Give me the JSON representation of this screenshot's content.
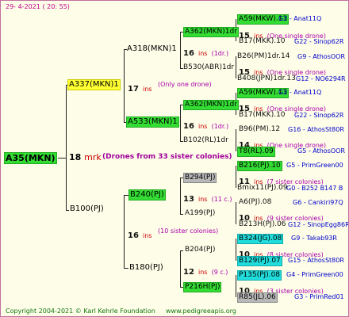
{
  "header": {
    "date": "29-  4-2021  ( 20:  55)"
  },
  "root": {
    "label": "A35(MKN)",
    "num": "18",
    "ins": "mrk",
    "note": "(Drones from 33 sister colonies)"
  },
  "gen1": {
    "top": {
      "label": "A337(MKN)1",
      "num": "17",
      "ins": "ins",
      "note": "(Only one drone)"
    },
    "bottom": {
      "label": "B100(PJ)",
      "num": "16",
      "ins": "ins",
      "note": "(10 sister colonies)"
    }
  },
  "gen2": {
    "a318": {
      "label": "A318(MKN)1",
      "num": "16",
      "ins": "ins",
      "note": "(1dr.)"
    },
    "a533": {
      "label": "A533(MKN)1",
      "num": "16",
      "ins": "ins",
      "note": "(1dr.)"
    },
    "b240": {
      "label": "B240(PJ)",
      "num": "13",
      "ins": "ins",
      "note": "(11 c.)"
    },
    "b180": {
      "label": "B180(PJ)",
      "num": "12",
      "ins": "ins",
      "note": "(9 c.)"
    }
  },
  "gen3": {
    "a362a": {
      "label": "A362(MKN)1dr",
      "num": "15",
      "ins": "ins",
      "note": "(One single drone)"
    },
    "b530": {
      "label": "B530(ABR)1dr",
      "num": "15",
      "ins": "ins",
      "note": "(One single drone)"
    },
    "a362b": {
      "label": "A362(MKN)1dr",
      "num": "15",
      "ins": "ins",
      "note": "(One single drone)"
    },
    "b102": {
      "label": "B102(RL)1dr",
      "num": "14",
      "ins": "ins",
      "note": "(One single drone)"
    },
    "b294": {
      "label": "B294(PJ)",
      "num": "11",
      "ins": "ins",
      "note": "(7 sister colonies)"
    },
    "a199": {
      "label": "A199(PJ)",
      "num": "10",
      "ins": "ins",
      "note": "(9 sister colonies)"
    },
    "b204": {
      "label": "B204(PJ)",
      "num": "10",
      "ins": "ins",
      "note": "(8 sister colonies)"
    },
    "p216": {
      "label": "P216H(PJ)",
      "num": "10",
      "ins": "ins",
      "note": "(3 sister colonies)"
    }
  },
  "gen4": [
    {
      "label": "A59(MKW).13",
      "right": "G2 - Anat11Q"
    },
    {
      "label": "B17(MKK).10",
      "right": "G22 - Sinop62R"
    },
    {
      "label": "B26(PM)1dr.14",
      "right": "G9 - AthosOOR"
    },
    {
      "label": "B408(JPN)1dr.13",
      "right": "G12 - NO6294R"
    },
    {
      "label": "A59(MKW).13",
      "right": "G2 - Anat11Q"
    },
    {
      "label": "B17(MKK).10",
      "right": "G22 - Sinop62R"
    },
    {
      "label": "B96(PM).12",
      "right": "G16 - AthosSt80R"
    },
    {
      "label": "T8(RL).09",
      "right": "G5 - AthosOOR"
    },
    {
      "label": "B216(PJ).10",
      "right": "G5 - PrimGreen00"
    },
    {
      "label": "Bmix11(PJ).09",
      "right": "G0 - B252 B147 B"
    },
    {
      "label": "A6(PJ).08",
      "right": "G6 - Cankiri97Q"
    },
    {
      "label": "B213H(PJ).06",
      "right": "G12 - SinopEgg86R"
    },
    {
      "label": "B324(JG).08",
      "right": "G9 - Takab93R"
    },
    {
      "label": "B129(PJ).07",
      "right": "G15 - AthosSt80R"
    },
    {
      "label": "P135(PJ).08",
      "right": "G4 - PrimGreen00"
    },
    {
      "label": "R85(JL).06",
      "right": "G3 - PrimRed01"
    }
  ],
  "footer": {
    "copyright": "Copyright 2004-2021 © Karl Kehrle Foundation",
    "url": "www.pedigreeapis.org"
  },
  "colors": {
    "green": "#33dd33",
    "yellow": "#ffff33",
    "cyan": "#22dddd",
    "grey": "#b8b8b8",
    "red": "#cc0000",
    "purple": "#aa00aa",
    "blue": "#0000cc"
  }
}
